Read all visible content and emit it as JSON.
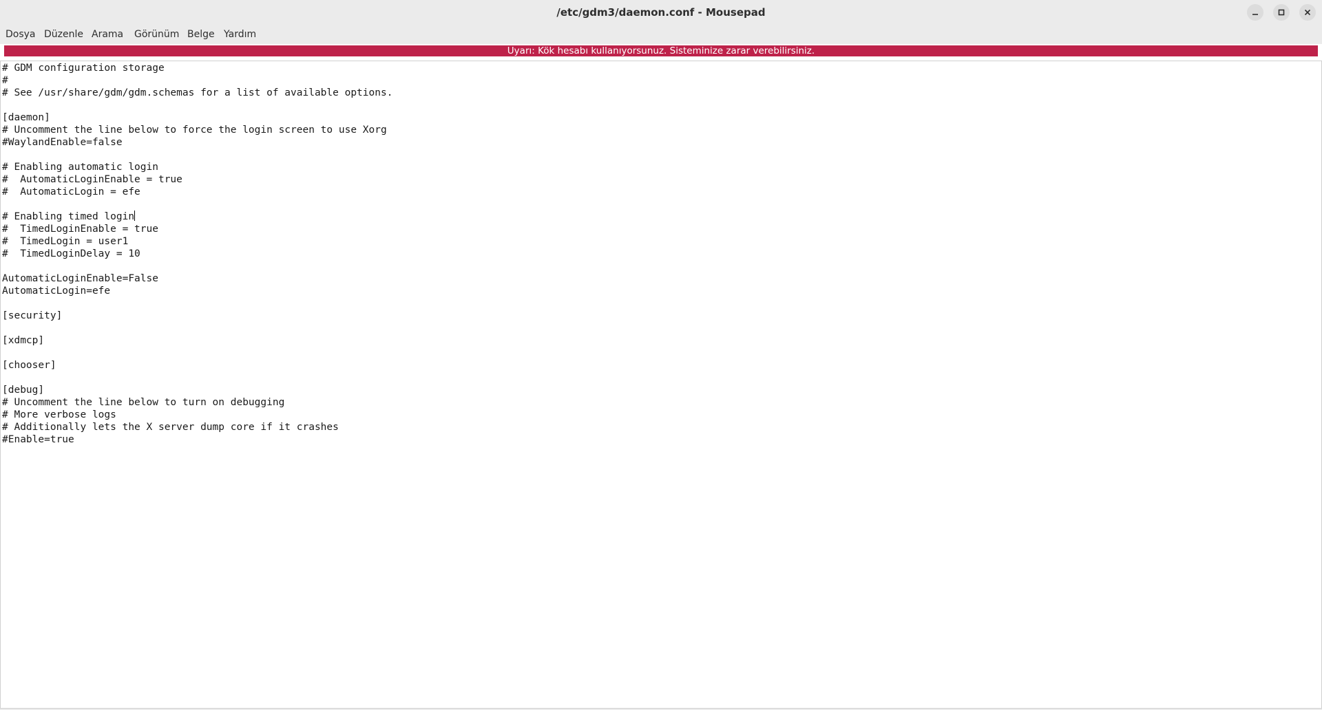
{
  "window": {
    "title": "/etc/gdm3/daemon.conf - Mousepad"
  },
  "window_controls": {
    "minimize_icon": "minimize-icon",
    "maximize_icon": "maximize-icon",
    "close_icon": "close-icon"
  },
  "menubar": {
    "items": [
      "Dosya",
      "Düzenle",
      "Arama",
      "Görünüm",
      "Belge",
      "Yardım"
    ]
  },
  "warning": {
    "text": "Uyarı: Kök hesabı kullanıyorsunuz. Sisteminize zarar verebilirsiniz.",
    "color": "#be224a"
  },
  "editor": {
    "lines": [
      "# GDM configuration storage",
      "#",
      "# See /usr/share/gdm/gdm.schemas for a list of available options.",
      "",
      "[daemon]",
      "# Uncomment the line below to force the login screen to use Xorg",
      "#WaylandEnable=false",
      "",
      "# Enabling automatic login",
      "#  AutomaticLoginEnable = true",
      "#  AutomaticLogin = efe",
      "",
      "# Enabling timed login",
      "#  TimedLoginEnable = true",
      "#  TimedLogin = user1",
      "#  TimedLoginDelay = 10",
      "",
      "AutomaticLoginEnable=False",
      "AutomaticLogin=efe",
      "",
      "[security]",
      "",
      "[xdmcp]",
      "",
      "[chooser]",
      "",
      "[debug]",
      "# Uncomment the line below to turn on debugging",
      "# More verbose logs",
      "# Additionally lets the X server dump core if it crashes",
      "#Enable=true"
    ]
  }
}
